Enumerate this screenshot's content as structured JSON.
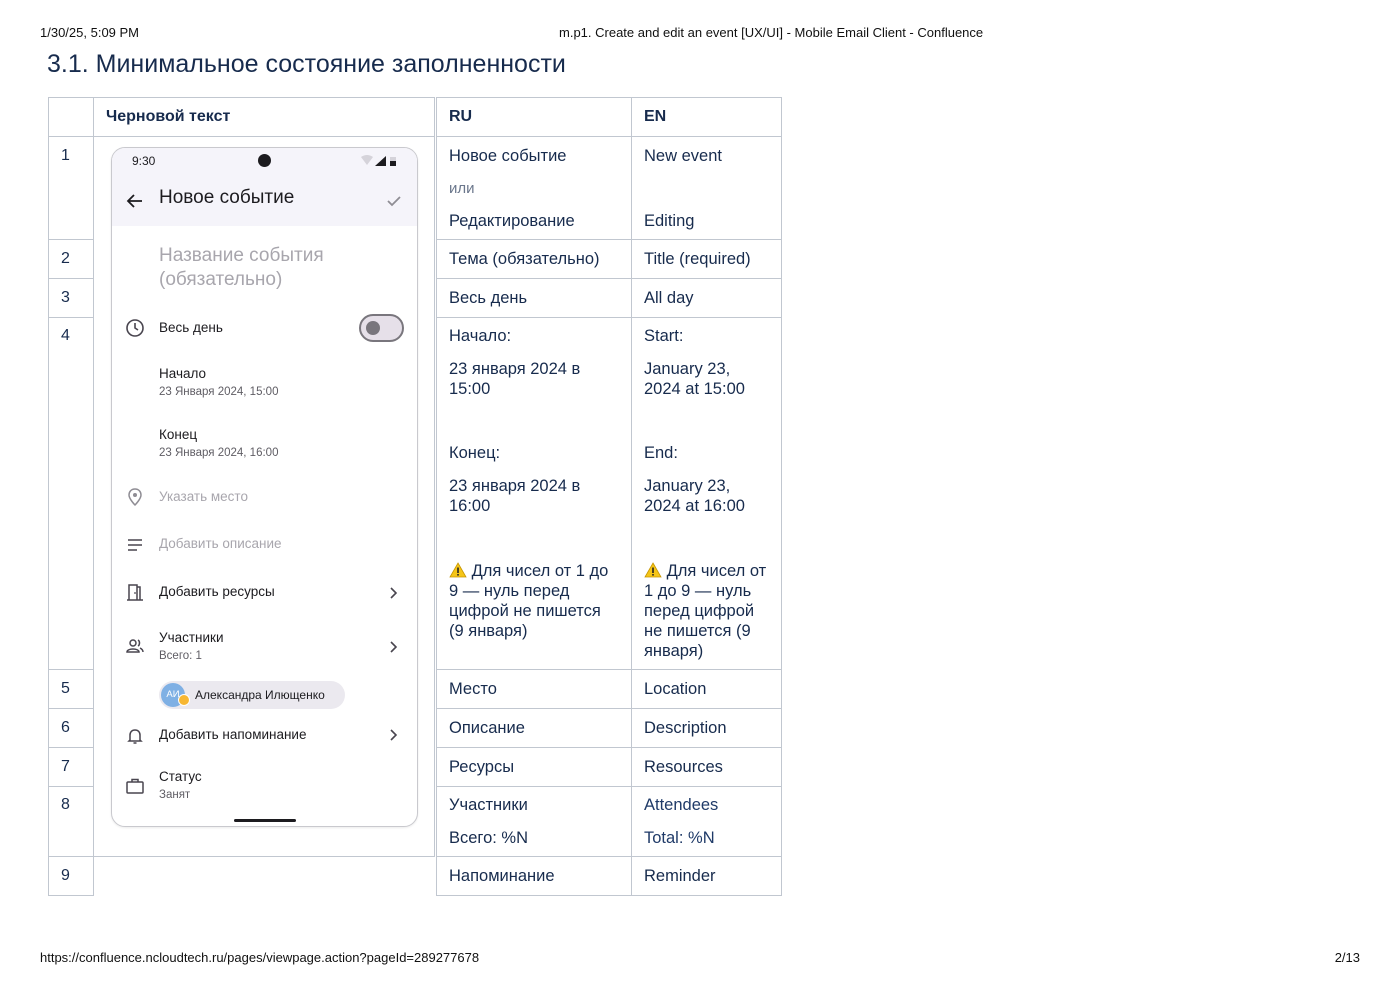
{
  "print_header": {
    "datetime": "1/30/25, 5:09 PM",
    "doc_title": "m.p1. Create and edit an event [UX/UI] - Mobile Email Client - Confluence"
  },
  "print_footer": {
    "url": "https://confluence.ncloudtech.ru/pages/viewpage.action?pageId=289277678",
    "page": "2/13"
  },
  "heading": "3.1. Минимальное состояние заполненности",
  "table": {
    "headers": {
      "draft": "Черновой текст",
      "ru": "RU",
      "en": "EN"
    },
    "rows": [
      {
        "num": "1",
        "ru": "Новое событие",
        "ru_or": "или",
        "ru2": "Редактирование",
        "en": "New event",
        "en2": "Editing"
      },
      {
        "num": "2",
        "ru": "Тема (обязательно)",
        "en": "Title (required)"
      },
      {
        "num": "3",
        "ru": "Весь день",
        "en": "All day"
      },
      {
        "num": "4",
        "ru_start_label": "Начало:",
        "ru_start_l1": "23 января 2024 в",
        "ru_start_l2": "15:00",
        "ru_end_label": "Конец:",
        "ru_end_l1": "23 января 2024 в",
        "ru_end_l2": "16:00",
        "ru_note": [
          "Для чисел от 1 до",
          "9 — нуль перед",
          "цифрой не пишется",
          "(9 января)"
        ],
        "en_start_label": "Start:",
        "en_start_l1": "January 23,",
        "en_start_l2": "2024 at 15:00",
        "en_end_label": "End:",
        "en_end_l1": "January 23,",
        "en_end_l2": "2024 at 16:00",
        "en_note": [
          "Для чисел от",
          "1 до 9 — нуль",
          "перед цифрой",
          "не пишется (9",
          "января)"
        ]
      },
      {
        "num": "5",
        "ru": "Место",
        "en": "Location"
      },
      {
        "num": "6",
        "ru": "Описание",
        "en": "Description"
      },
      {
        "num": "7",
        "ru": "Ресурсы",
        "en": "Resources"
      },
      {
        "num": "8",
        "ru": "Участники",
        "ru2": "Всего: %N",
        "en": "Attendees",
        "en2": "Total: %N"
      },
      {
        "num": "9",
        "ru": "Напоминание",
        "en": "Reminder"
      }
    ]
  },
  "phone": {
    "status_time": "9:30",
    "app_title": "Новое событие",
    "title_placeholder_l1": "Название события",
    "title_placeholder_l2": "(обязательно)",
    "all_day": "Весь день",
    "start_label": "Начало",
    "start_value": "23 Января 2024, 15:00",
    "end_label": "Конец",
    "end_value": "23 Января 2024, 16:00",
    "location": "Указать место",
    "description": "Добавить описание",
    "resources": "Добавить ресурсы",
    "attendees": "Участники",
    "attendees_total": "Всего: 1",
    "chip_initials": "АИ",
    "chip_name": "Александра Илющенко",
    "reminder": "Добавить напоминание",
    "status_label": "Статус",
    "status_value": "Занят"
  },
  "colors": {
    "text": "#172b4d",
    "border": "#c1c7d0",
    "link": "#1f3a68"
  }
}
